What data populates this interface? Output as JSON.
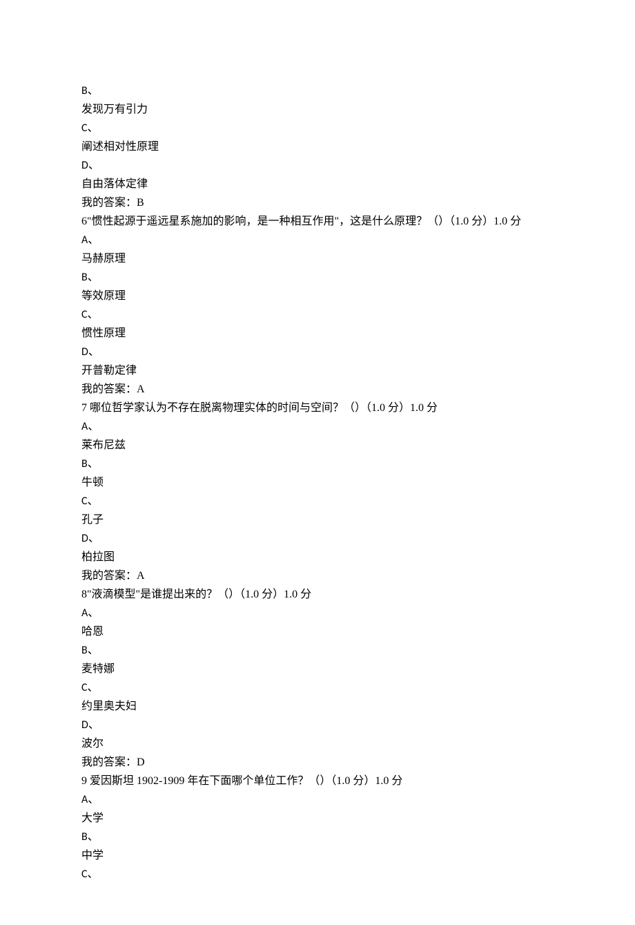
{
  "lines": [
    {
      "t": "B、",
      "latin": true
    },
    {
      "t": "发现万有引力"
    },
    {
      "t": "C、",
      "latin": true
    },
    {
      "t": "阐述相对性原理"
    },
    {
      "t": "D、",
      "latin": true
    },
    {
      "t": "自由落体定律"
    },
    {
      "t": "我的答案：B"
    },
    {
      "t": "6\"惯性起源于遥远星系施加的影响，是一种相互作用\"，这是什么原理？（）（1.0 分）1.0 分"
    },
    {
      "t": "A、",
      "latin": true
    },
    {
      "t": "马赫原理"
    },
    {
      "t": "B、",
      "latin": true
    },
    {
      "t": "等效原理"
    },
    {
      "t": "C、",
      "latin": true
    },
    {
      "t": "惯性原理"
    },
    {
      "t": "D、",
      "latin": true
    },
    {
      "t": "开普勒定律"
    },
    {
      "t": "我的答案：A"
    },
    {
      "t": "7 哪位哲学家认为不存在脱离物理实体的时间与空间？（）（1.0 分）1.0 分"
    },
    {
      "t": "A、",
      "latin": true
    },
    {
      "t": "莱布尼兹"
    },
    {
      "t": "B、",
      "latin": true
    },
    {
      "t": "牛顿"
    },
    {
      "t": "C、",
      "latin": true
    },
    {
      "t": "孔子"
    },
    {
      "t": "D、",
      "latin": true
    },
    {
      "t": "柏拉图"
    },
    {
      "t": "我的答案：A"
    },
    {
      "t": "8\"液滴模型\"是谁提出来的？（）（1.0 分）1.0 分"
    },
    {
      "t": "A、",
      "latin": true
    },
    {
      "t": "哈恩"
    },
    {
      "t": "B、",
      "latin": true
    },
    {
      "t": "麦特娜"
    },
    {
      "t": "C、",
      "latin": true
    },
    {
      "t": "约里奥夫妇"
    },
    {
      "t": "D、",
      "latin": true
    },
    {
      "t": "波尔"
    },
    {
      "t": "我的答案：D"
    },
    {
      "t": "9 爱因斯坦 1902-1909 年在下面哪个单位工作？（）（1.0 分）1.0 分"
    },
    {
      "t": "A、",
      "latin": true
    },
    {
      "t": "大学"
    },
    {
      "t": "B、",
      "latin": true
    },
    {
      "t": "中学"
    },
    {
      "t": "C、",
      "latin": true
    }
  ]
}
